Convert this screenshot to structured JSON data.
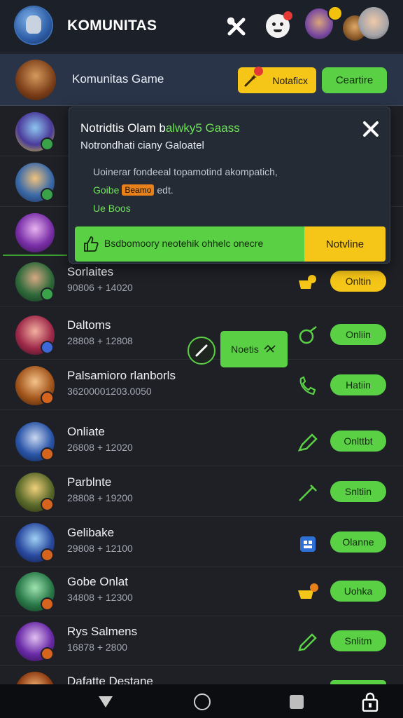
{
  "app": {
    "title": "KOMUNITAS"
  },
  "banner": {
    "title": "Komunitas Game",
    "notify_label": "Notaficx",
    "create_label": "Ceartire"
  },
  "popup": {
    "title_a": "Notridtis Olam b",
    "title_b": "alwky5 Gaass",
    "subtitle": "Notrondhati ciany Galoatel",
    "body": "Uoinerar fondeeal topamotind akompatich,",
    "line2_green": "Goibe",
    "line2_tag": "Beamo",
    "line2_rest": "edt.",
    "line3": "Ue Boos",
    "cta_text": "Bsdbomoory neotehik ohhelc onecre",
    "cta_button": "Notvline"
  },
  "floating": {
    "note_label": "Noetis"
  },
  "rows": [
    {
      "name": "Sorlaites",
      "meta": "90806 + 14020",
      "status": "Onltin",
      "status_color": "yellow"
    },
    {
      "name": "Daltoms",
      "meta": "28808 + 12808",
      "status": "Onliin",
      "status_color": "green"
    },
    {
      "name": "Palsamioro rlanborls",
      "meta": "36200001203.0050",
      "status": "Hatiin",
      "status_color": "green"
    },
    {
      "name": "Onliate",
      "meta": "26808 + 12020",
      "status": "Onlttbt",
      "status_color": "green"
    },
    {
      "name": "Parblnte",
      "meta": "28808 + 19200",
      "status": "Snltiin",
      "status_color": "green"
    },
    {
      "name": "Gelibake",
      "meta": "29808 + 12100",
      "status": "Olanne",
      "status_color": "green"
    },
    {
      "name": "Gobe Onlat",
      "meta": "34808 + 12300",
      "status": "Uohka",
      "status_color": "green"
    },
    {
      "name": "Rys Salmens",
      "meta": "16878 + 2800",
      "status": "Snlitm",
      "status_color": "green"
    },
    {
      "name": "Dafatte Destane",
      "meta": "",
      "status": "",
      "status_color": "green"
    }
  ],
  "colors": {
    "accent_green": "#5ad145",
    "accent_yellow": "#f5c518",
    "background": "#1e2026"
  },
  "icons": [
    "app-logo",
    "tools-icon",
    "smiley-icon",
    "wand-icon",
    "close-icon",
    "thumbs-up-icon",
    "pen-icon",
    "triangle-back-icon",
    "circle-home-icon",
    "square-recents-icon",
    "lock-icon"
  ]
}
